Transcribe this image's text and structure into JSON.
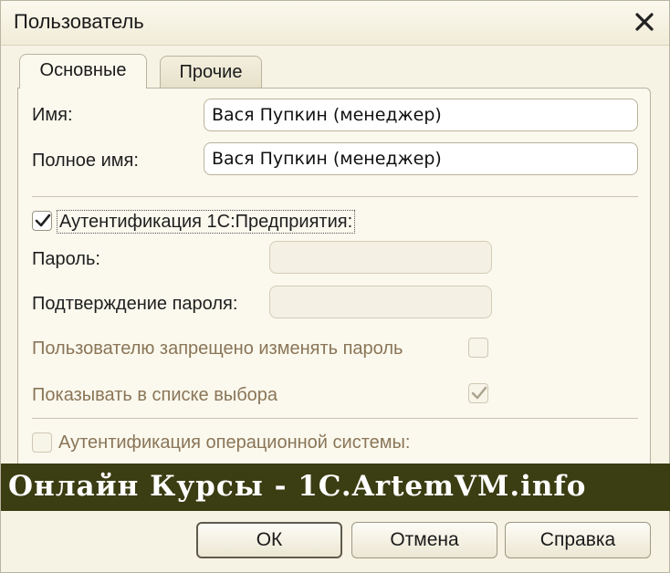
{
  "window": {
    "title": "Пользователь"
  },
  "tabs": [
    {
      "label": "Основные",
      "active": true
    },
    {
      "label": "Прочие",
      "active": false
    }
  ],
  "form": {
    "name": {
      "label": "Имя:",
      "value": "Вася Пупкин (менеджер)"
    },
    "full_name": {
      "label": "Полное имя:",
      "value": "Вася Пупкин (менеджер)"
    },
    "auth_1c": {
      "label": "Аутентификация 1С:Предприятия:",
      "checked": true
    },
    "password": {
      "label": "Пароль:",
      "value": ""
    },
    "password_confirm": {
      "label": "Подтверждение пароля:",
      "value": ""
    },
    "no_change_password": {
      "label": "Пользователю запрещено изменять пароль",
      "checked": false
    },
    "show_in_list": {
      "label": "Показывать в списке выбора",
      "checked": true
    },
    "auth_os": {
      "label": "Аутентификация операционной системы:",
      "checked": false
    }
  },
  "banner": {
    "text": "Онлайн Курсы - 1C.ArtemVM.info"
  },
  "buttons": {
    "ok": "ОК",
    "cancel": "Отмена",
    "help": "Справка"
  },
  "colors": {
    "window_bg": "#f6f3e4",
    "disabled_text": "#8a7557",
    "banner_bg": "#3b3d12"
  },
  "icons": {
    "close": "close-icon",
    "check": "checkmark-icon"
  }
}
